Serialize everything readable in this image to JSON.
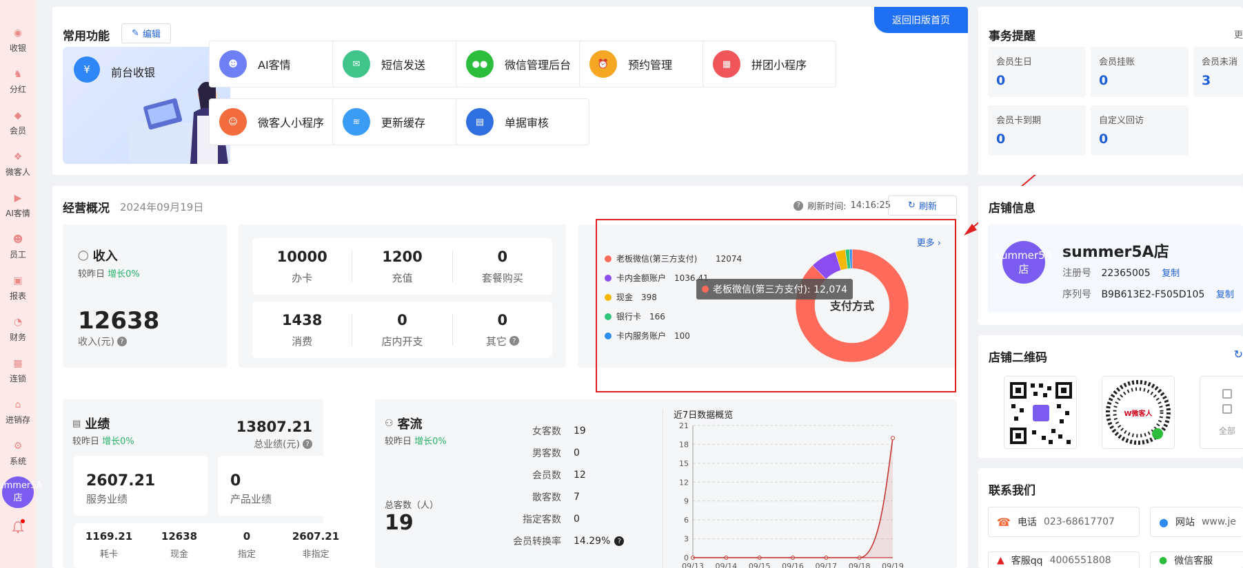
{
  "sidebar": {
    "items": [
      {
        "label": "收银"
      },
      {
        "label": "分红"
      },
      {
        "label": "会员"
      },
      {
        "label": "微客人"
      },
      {
        "label": "AI客情"
      },
      {
        "label": "员工"
      },
      {
        "label": "报表"
      },
      {
        "label": "财务"
      },
      {
        "label": "连锁"
      },
      {
        "label": "进销存"
      },
      {
        "label": "系统"
      }
    ],
    "avatar": "summer5A店"
  },
  "common": {
    "title": "常用功能",
    "edit_label": "编辑",
    "back_label": "返回旧版首页",
    "hero_label": "前台收银",
    "tiles": [
      {
        "label": "AI客情",
        "color": "#6f7ff5"
      },
      {
        "label": "短信发送",
        "color": "#3fc58a"
      },
      {
        "label": "微信管理后台",
        "color": "#2bbd3b"
      },
      {
        "label": "预约管理",
        "color": "#f5a623"
      },
      {
        "label": "拼团小程序",
        "color": "#f0555a"
      },
      {
        "label": "微客人小程序",
        "color": "#f26c3d"
      },
      {
        "label": "更新缓存",
        "color": "#3b9cf6"
      },
      {
        "label": "单据审核",
        "color": "#2f6fe0"
      }
    ]
  },
  "overview": {
    "title": "经营概况",
    "date": "2024年09月19日",
    "refresh_time_label": "刷新时间:",
    "refresh_time": "14:16:25",
    "refresh_label": "刷新",
    "income": {
      "title": "收入",
      "compare_label": "较昨日",
      "compare_value": "增长0%",
      "value": "12638",
      "unit_label": "收入(元)"
    },
    "stats_top": [
      {
        "value": "10000",
        "label": "办卡"
      },
      {
        "value": "1200",
        "label": "充值"
      },
      {
        "value": "0",
        "label": "套餐购买"
      }
    ],
    "stats_bottom": [
      {
        "value": "1438",
        "label": "消费"
      },
      {
        "value": "0",
        "label": "店内开支"
      },
      {
        "value": "0",
        "label": "其它"
      }
    ],
    "performance": {
      "title": "业绩",
      "compare_label": "较昨日",
      "compare_value": "增长0%",
      "total": "13807.21",
      "total_label": "总业绩(元)",
      "service": {
        "value": "2607.21",
        "label": "服务业绩"
      },
      "product": {
        "value": "0",
        "label": "产品业绩"
      },
      "mini": [
        {
          "value": "1169.21",
          "label": "耗卡"
        },
        {
          "value": "12638",
          "label": "现金"
        },
        {
          "value": "0",
          "label": "指定"
        },
        {
          "value": "2607.21",
          "label": "非指定"
        }
      ]
    },
    "flow": {
      "title": "客流",
      "compare_label": "较昨日",
      "compare_value": "增长0%",
      "total_label": "总客数（人）",
      "total": "19",
      "rows": [
        {
          "k": "女客数",
          "v": "19"
        },
        {
          "k": "男客数",
          "v": "0"
        },
        {
          "k": "会员数",
          "v": "12"
        },
        {
          "k": "散客数",
          "v": "7"
        },
        {
          "k": "指定客数",
          "v": "0"
        },
        {
          "k": "会员转换率",
          "v": "14.29%"
        }
      ]
    }
  },
  "payment": {
    "more_label": "更多",
    "center_label": "支付方式",
    "tooltip": "老板微信(第三方支付): 12,074"
  },
  "chart_data": [
    {
      "type": "pie",
      "title": "支付方式",
      "labels": [
        "老板微信(第三方支付)",
        "卡内金额账户",
        "现金",
        "银行卡",
        "卡内服务账户"
      ],
      "values": [
        12074,
        1036.41,
        398,
        166,
        100
      ],
      "value_labels": [
        "12074",
        "1036.41",
        "398",
        "166",
        "100"
      ],
      "colors": [
        "#ff6b5b",
        "#8b4cf0",
        "#f5b800",
        "#2fc67c",
        "#2f8cf0"
      ],
      "legend": "left"
    },
    {
      "type": "area",
      "title": "近7日数据概览",
      "x": [
        "09/13",
        "09/14",
        "09/15",
        "09/16",
        "09/17",
        "09/18",
        "09/19"
      ],
      "values": [
        0,
        0,
        0,
        0,
        0,
        0,
        19
      ],
      "ylim": [
        0,
        21
      ],
      "yticks": [
        "0",
        "3",
        "6",
        "9",
        "12",
        "15",
        "18",
        "21"
      ],
      "color": "#c23531",
      "grid": true
    }
  ],
  "reminder": {
    "title": "事务提醒",
    "more": "更",
    "items": [
      {
        "label": "会员生日",
        "value": "0"
      },
      {
        "label": "会员挂账",
        "value": "0"
      },
      {
        "label": "会员未消",
        "value": "3"
      },
      {
        "label": "会员卡到期",
        "value": "0"
      },
      {
        "label": "自定义回访",
        "value": "0"
      }
    ]
  },
  "store": {
    "title": "店铺信息",
    "avatar": "summer5A店",
    "name": "summer5A店",
    "reg_label": "注册号",
    "reg_value": "22365005",
    "serial_label": "序列号",
    "serial_value": "B9B613E2-F505D105",
    "copy_label": "复制"
  },
  "qrcode": {
    "title": "店铺二维码",
    "brand": "W微客人",
    "more": "全部"
  },
  "contact": {
    "title": "联系我们",
    "phone_label": "电话",
    "phone_value": "023-68617707",
    "site_label": "网站",
    "site_value": "www.je",
    "qq_label": "客服qq",
    "qq_value": "4006551808",
    "wechat_label": "微信客服"
  }
}
